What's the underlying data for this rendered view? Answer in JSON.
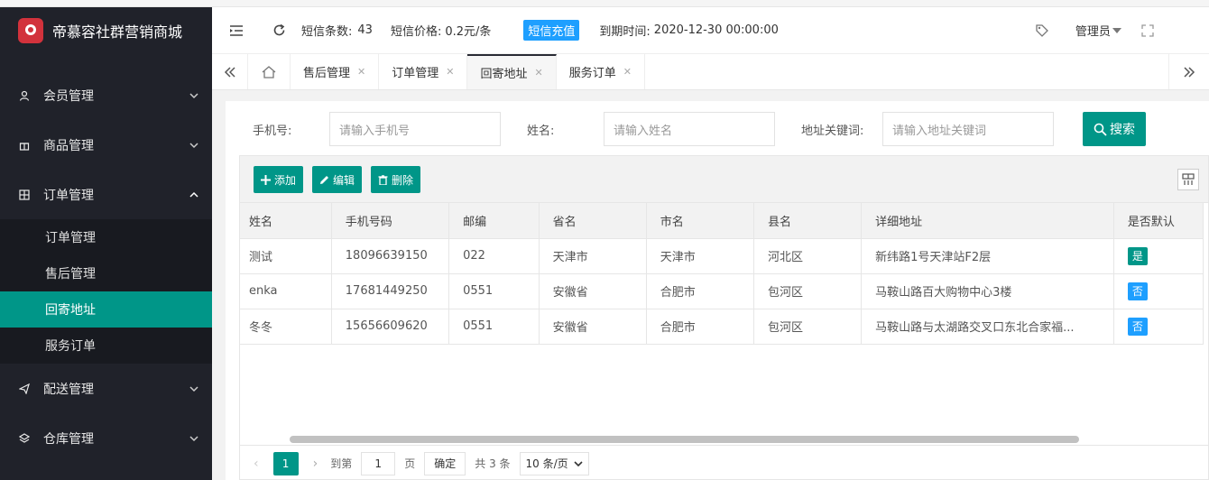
{
  "app": {
    "title": "帝慕容社群营销商城",
    "logo_text": "帝慕容"
  },
  "sidebar": {
    "items": [
      {
        "label": "会员管理",
        "icon": "user-icon"
      },
      {
        "label": "商品管理",
        "icon": "gift-icon"
      },
      {
        "label": "订单管理",
        "icon": "grid-icon",
        "expanded": true
      },
      {
        "label": "配送管理",
        "icon": "send-icon"
      },
      {
        "label": "仓库管理",
        "icon": "layers-icon"
      }
    ],
    "submenu": [
      {
        "label": "订单管理"
      },
      {
        "label": "售后管理"
      },
      {
        "label": "回寄地址",
        "active": true
      },
      {
        "label": "服务订单"
      }
    ]
  },
  "header": {
    "sms_count_label": "短信条数:",
    "sms_count": "43",
    "sms_price_label": "短信价格:",
    "sms_price": "0.2元/条",
    "recharge_label": "短信充值",
    "expire_label": "到期时间:",
    "expire_value": "2020-12-30 00:00:00",
    "admin_label": "管理员"
  },
  "tabs": [
    {
      "label": "售后管理"
    },
    {
      "label": "订单管理"
    },
    {
      "label": "回寄地址",
      "active": true
    },
    {
      "label": "服务订单"
    }
  ],
  "search": {
    "phone_label": "手机号:",
    "phone_placeholder": "请输入手机号",
    "name_label": "姓名:",
    "name_placeholder": "请输入姓名",
    "addr_label": "地址关键词:",
    "addr_placeholder": "请输入地址关键词",
    "button_label": "搜索"
  },
  "toolbar": {
    "add_label": "添加",
    "edit_label": "编辑",
    "delete_label": "删除"
  },
  "table": {
    "columns": [
      "姓名",
      "手机号码",
      "邮编",
      "省名",
      "市名",
      "县名",
      "详细地址",
      "是否默认"
    ],
    "rows": [
      {
        "name": "测试",
        "phone": "18096639150",
        "zip": "022",
        "province": "天津市",
        "city": "天津市",
        "county": "河北区",
        "address": "新纬路1号天津站F2层",
        "default": "是"
      },
      {
        "name": "enka",
        "phone": "17681449250",
        "zip": "0551",
        "province": "安徽省",
        "city": "合肥市",
        "county": "包河区",
        "address": "马鞍山路百大购物中心3楼",
        "default": "否"
      },
      {
        "name": "冬冬",
        "phone": "15656609620",
        "zip": "0551",
        "province": "安徽省",
        "city": "合肥市",
        "county": "包河区",
        "address": "马鞍山路与太湖路交叉口东北合家福...",
        "default": "否"
      }
    ]
  },
  "pager": {
    "current_page": "1",
    "goto_label": "到第",
    "goto_value": "1",
    "page_unit": "页",
    "confirm_label": "确定",
    "total_label": "共 3 条",
    "page_size": "10 条/页"
  },
  "colors": {
    "sidebar_bg": "#20222a",
    "accent": "#009688",
    "blue": "#1e9fff"
  }
}
